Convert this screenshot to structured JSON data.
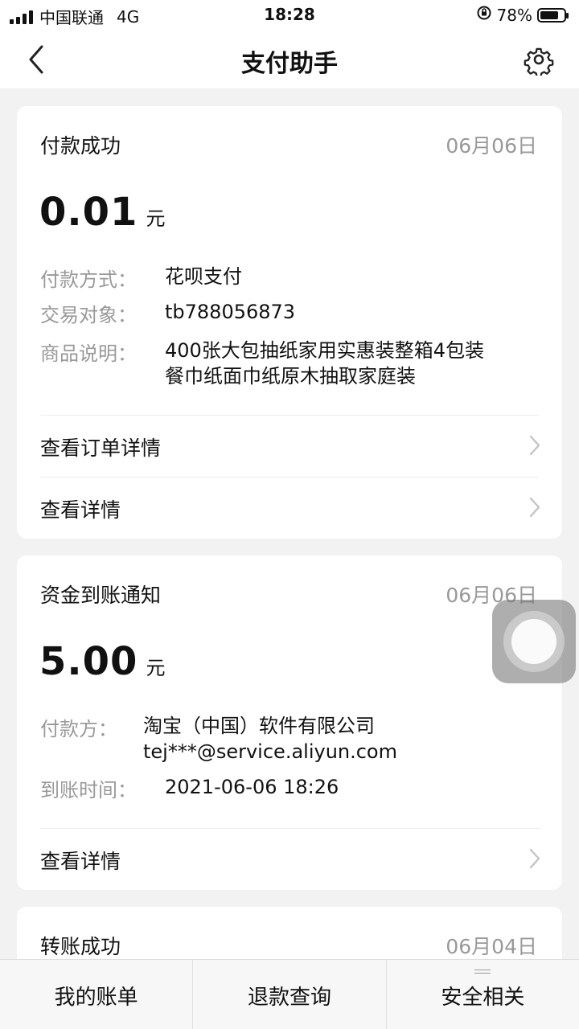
{
  "status_bar": {
    "carrier": "中国联通",
    "network": "4G",
    "time": "18:28",
    "battery": "78%",
    "battery_level": 0.78
  },
  "nav": {
    "title": "支付助手"
  },
  "cards": [
    {
      "title": "付款成功",
      "date": "06月06日",
      "amount": "0.01",
      "unit": "元",
      "rows": [
        {
          "label": "付款方式：",
          "value": "花呗支付"
        },
        {
          "label": "交易对象：",
          "value": "tb788056873"
        },
        {
          "label": "商品说明：",
          "value_line1": "400张大包抽纸家用实惠装整箱4包装",
          "value_line2": "餐巾纸面巾纸原木抽取家庭装"
        }
      ],
      "links": [
        "查看订单详情",
        "查看详情"
      ]
    },
    {
      "title": "资金到账通知",
      "date": "06月06日",
      "amount": "5.00",
      "unit": "元",
      "rows": [
        {
          "label": "付款方：",
          "value_line1": "淘宝（中国）软件有限公司",
          "value_line2": "tej***@service.aliyun.com"
        },
        {
          "label": "到账时间：",
          "value": "2021-06-06 18:26"
        }
      ],
      "links": [
        "查看详情"
      ]
    },
    {
      "title": "转账成功",
      "date": "06月04日"
    }
  ],
  "tabs": [
    "我的账单",
    "退款查询",
    "安全相关"
  ]
}
